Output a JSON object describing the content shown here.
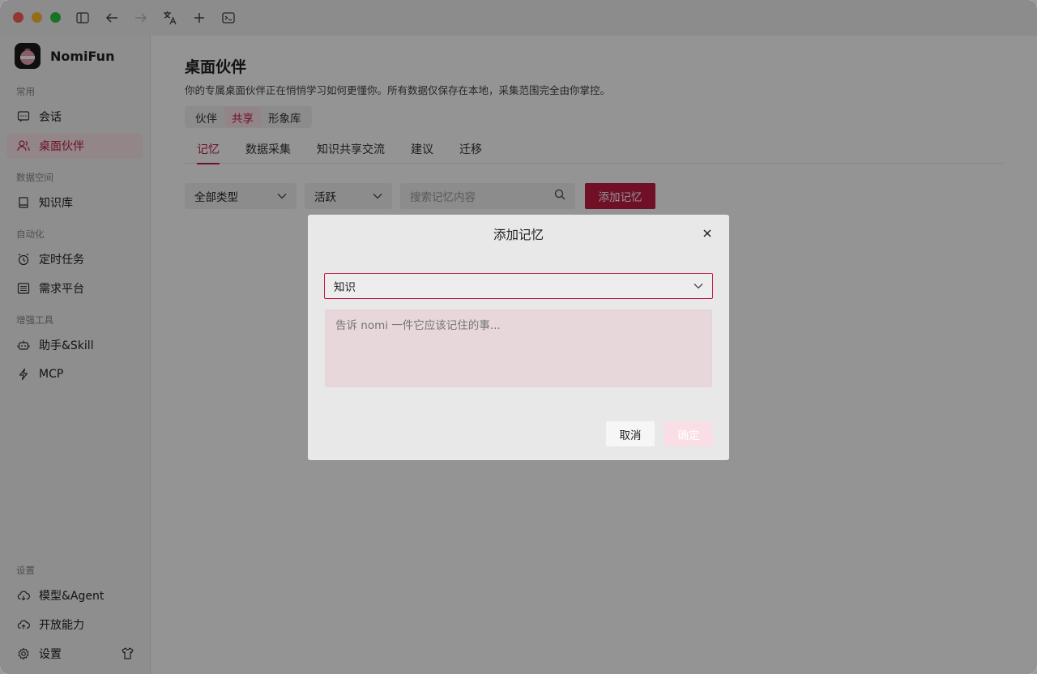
{
  "window": {
    "toolbar_icons": [
      "sidebar-toggle-icon",
      "back-arrow-icon",
      "forward-arrow-icon",
      "translate-icon",
      "plus-icon",
      "terminal-icon"
    ]
  },
  "sidebar": {
    "app_name": "NomiFun",
    "sections": {
      "common": "常用",
      "data_space": "数据空间",
      "automation": "自动化",
      "tools": "增强工具",
      "settings": "设置"
    },
    "items": {
      "chat": "会话",
      "desktop_partner": "桌面伙伴",
      "knowledge": "知识库",
      "scheduled": "定时任务",
      "demand": "需求平台",
      "assistant": "助手&Skill",
      "mcp": "MCP",
      "model": "模型&Agent",
      "open": "开放能力",
      "settings": "设置"
    }
  },
  "main": {
    "title": "桌面伙伴",
    "subtitle": "你的专属桌面伙伴正在悄悄学习如何更懂你。所有数据仅保存在本地，采集范围完全由你掌控。",
    "segments": [
      "伙伴",
      "共享",
      "形象库"
    ],
    "active_segment": "共享",
    "tabs": [
      "记忆",
      "数据采集",
      "知识共享交流",
      "建议",
      "迁移"
    ],
    "active_tab": "记忆",
    "filter_type": "全部类型",
    "filter_status": "活跃",
    "search_placeholder": "搜索记忆内容",
    "add_button": "添加记忆"
  },
  "modal": {
    "title": "添加记忆",
    "type_value": "知识",
    "content_placeholder": "告诉 nomi 一件它应该记住的事...",
    "cancel": "取消",
    "confirm": "确定"
  },
  "colors": {
    "accent": "#c01c44",
    "accent_light": "#fbe7ec"
  }
}
